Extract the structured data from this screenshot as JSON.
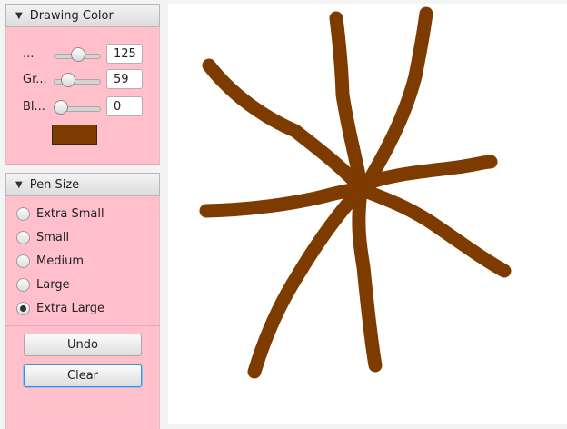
{
  "drawing_color": {
    "title": "Drawing Color",
    "sliders": [
      {
        "label": "...",
        "value": "125"
      },
      {
        "label": "Gr...",
        "value": "59"
      },
      {
        "label": "Bl...",
        "value": "0"
      }
    ],
    "swatch_color": "#7d3b00"
  },
  "pen_size": {
    "title": "Pen Size",
    "options": [
      "Extra Small",
      "Small",
      "Medium",
      "Large",
      "Extra Large"
    ],
    "selected": "Extra Large"
  },
  "buttons": {
    "undo": "Undo",
    "clear": "Clear"
  },
  "colors": {
    "panel_bg": "#ffc0cb",
    "stroke": "#7d3b00",
    "canvas_bg": "#ffffff"
  }
}
